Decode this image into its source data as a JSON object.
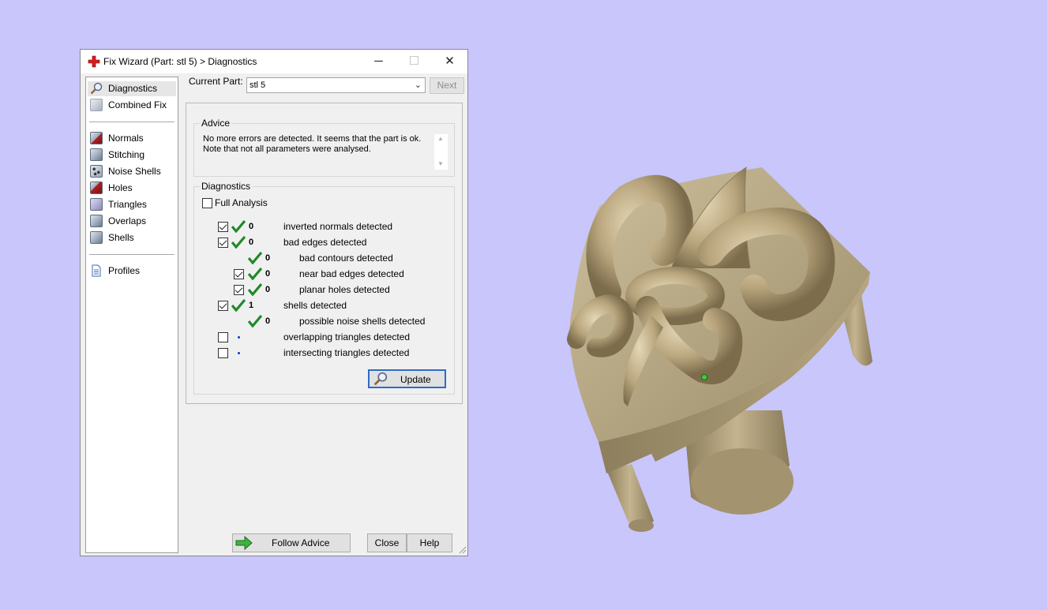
{
  "window": {
    "title": "Fix Wizard (Part: stl 5) > Diagnostics",
    "minimize": "─",
    "maximize": "☐",
    "close": "✕"
  },
  "sidebar": {
    "items": [
      {
        "label": "Diagnostics",
        "icon": "magnifier-icon",
        "selected": true
      },
      {
        "label": "Combined Fix",
        "icon": "cube-icon"
      },
      {
        "label": "Normals",
        "icon": "normals-cube-icon"
      },
      {
        "label": "Stitching",
        "icon": "stitching-cube-icon"
      },
      {
        "label": "Noise Shells",
        "icon": "noise-shells-cube-icon"
      },
      {
        "label": "Holes",
        "icon": "holes-cube-icon"
      },
      {
        "label": "Triangles",
        "icon": "triangles-cube-icon"
      },
      {
        "label": "Overlaps",
        "icon": "overlaps-cube-icon"
      },
      {
        "label": "Shells",
        "icon": "shells-cube-icon"
      },
      {
        "label": "Profiles",
        "icon": "document-icon"
      }
    ]
  },
  "top": {
    "current_part_label": "Current Part:",
    "current_part_value": "stl 5",
    "next_label": "Next"
  },
  "advice": {
    "legend": "Advice",
    "line1": "No more errors are detected. It seems that the part is ok.",
    "line2": "Note that not all parameters were analysed."
  },
  "diagnostics": {
    "legend": "Diagnostics",
    "full_analysis_label": "Full Analysis",
    "full_analysis_checked": false,
    "rows": [
      {
        "checkbox": true,
        "checked": true,
        "status": "ok",
        "count": "0",
        "label": "inverted normals detected",
        "indent": 0
      },
      {
        "checkbox": true,
        "checked": true,
        "status": "ok",
        "count": "0",
        "label": "bad edges detected",
        "indent": 0
      },
      {
        "checkbox": false,
        "checked": false,
        "status": "ok",
        "count": "0",
        "label": "bad contours detected",
        "indent": 1
      },
      {
        "checkbox": true,
        "checked": true,
        "status": "ok",
        "count": "0",
        "label": "near bad edges detected",
        "indent": 1
      },
      {
        "checkbox": true,
        "checked": true,
        "status": "ok",
        "count": "0",
        "label": "planar holes detected",
        "indent": 1
      },
      {
        "checkbox": true,
        "checked": true,
        "status": "ok",
        "count": "1",
        "label": "shells detected",
        "indent": 0
      },
      {
        "checkbox": false,
        "checked": false,
        "status": "ok",
        "count": "0",
        "label": "possible noise shells detected",
        "indent": 1
      },
      {
        "checkbox": true,
        "checked": false,
        "status": "none",
        "count": "",
        "label": "overlapping triangles detected",
        "indent": 0
      },
      {
        "checkbox": true,
        "checked": false,
        "status": "none",
        "count": "",
        "label": "intersecting triangles detected",
        "indent": 0
      }
    ],
    "update_label": "Update"
  },
  "buttons": {
    "follow_advice": "Follow Advice",
    "close": "Close",
    "help": "Help"
  },
  "colors": {
    "background": "#c8c6fb",
    "model": "#b3a382",
    "ok_tick": "#1f8a2a",
    "dot": "#1038c8"
  }
}
